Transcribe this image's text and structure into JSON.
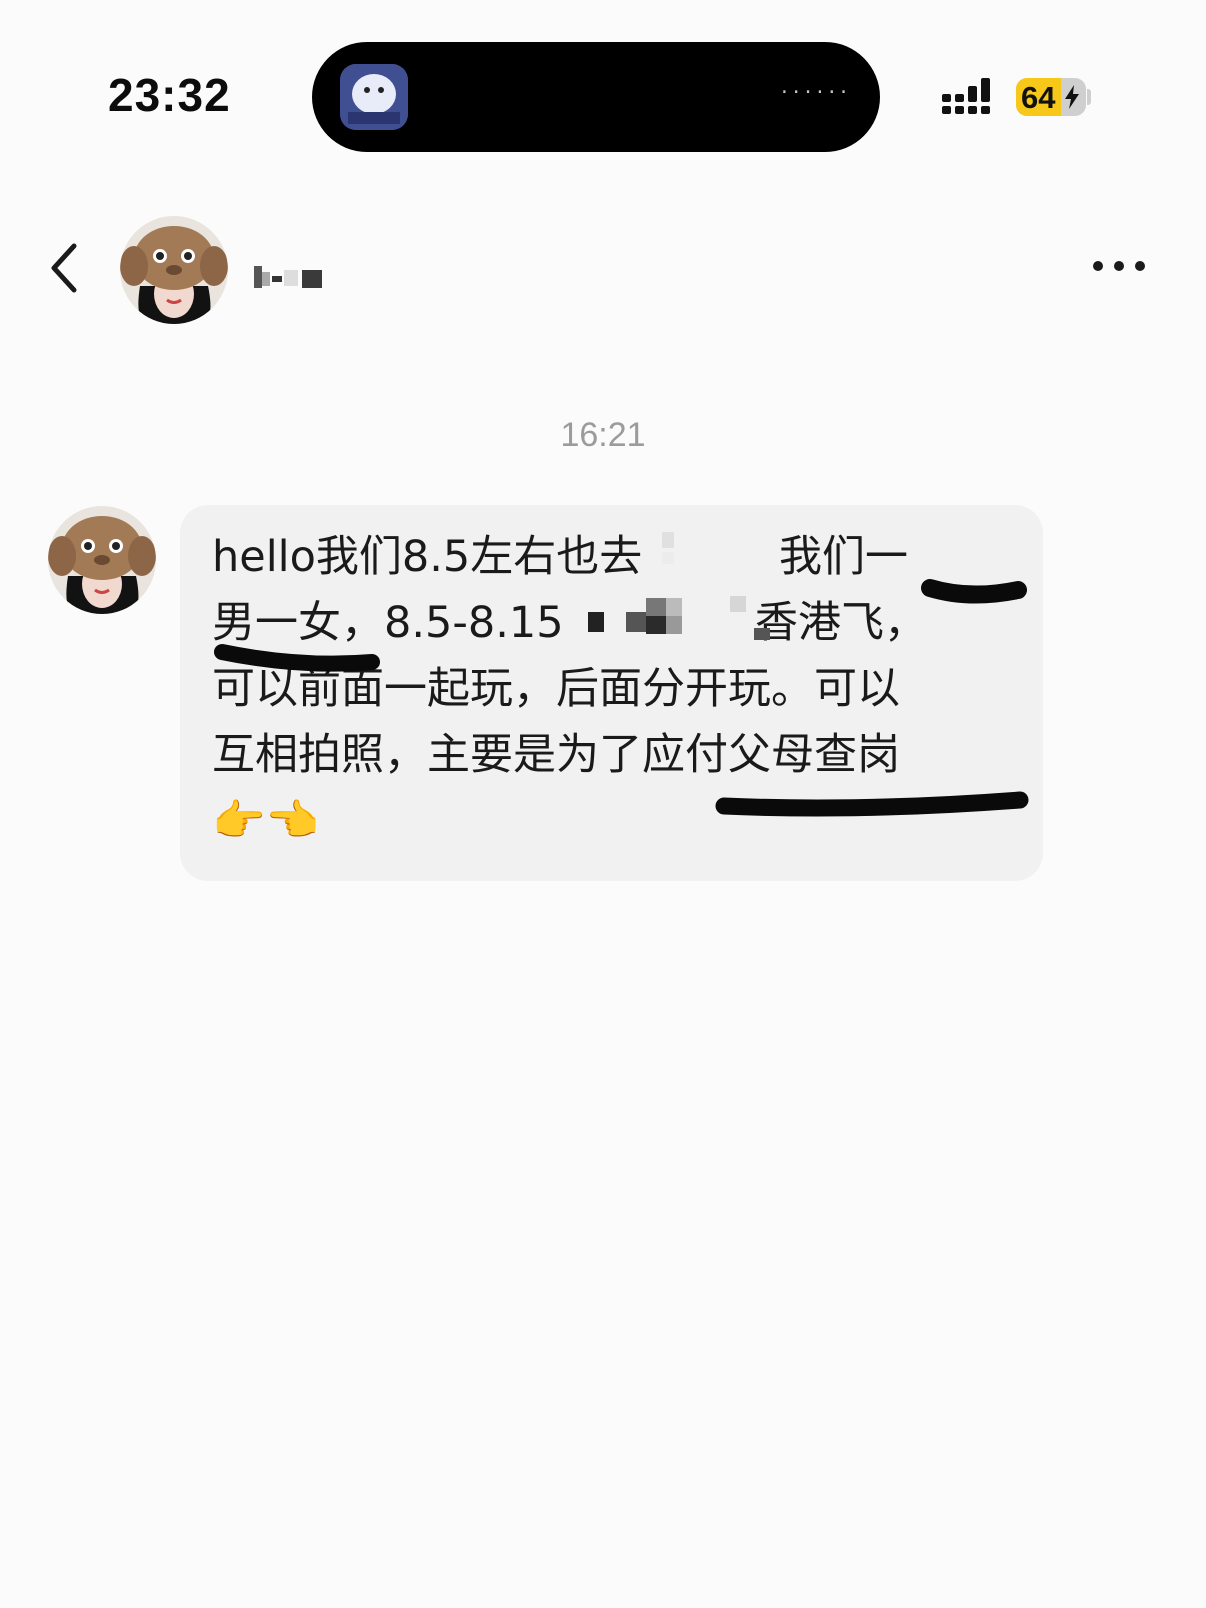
{
  "status_bar": {
    "time": "23:32",
    "island_indicator": "······",
    "battery_percent": "64",
    "battery_level": 0.64,
    "signal_bars": 4
  },
  "header": {
    "back_icon": "chevron-left-icon",
    "more_icon": "ellipsis-icon"
  },
  "conversation": {
    "timestamp": "16:21",
    "messages": [
      {
        "sender": "contact",
        "text": "hello我们8.5左右也去          我们一\n男一女，8.5-8.15              香港飞，\n可以前面一起玩，后面分开玩。可以\n互相拍照，主要是为了应付父母查岗\n👉👈"
      }
    ]
  },
  "colors": {
    "background": "#fbfbfb",
    "bubble": "#f1f1f1",
    "battery": "#f7c81a",
    "text": "#1a1a1a",
    "timestamp": "#9b9b9b"
  }
}
